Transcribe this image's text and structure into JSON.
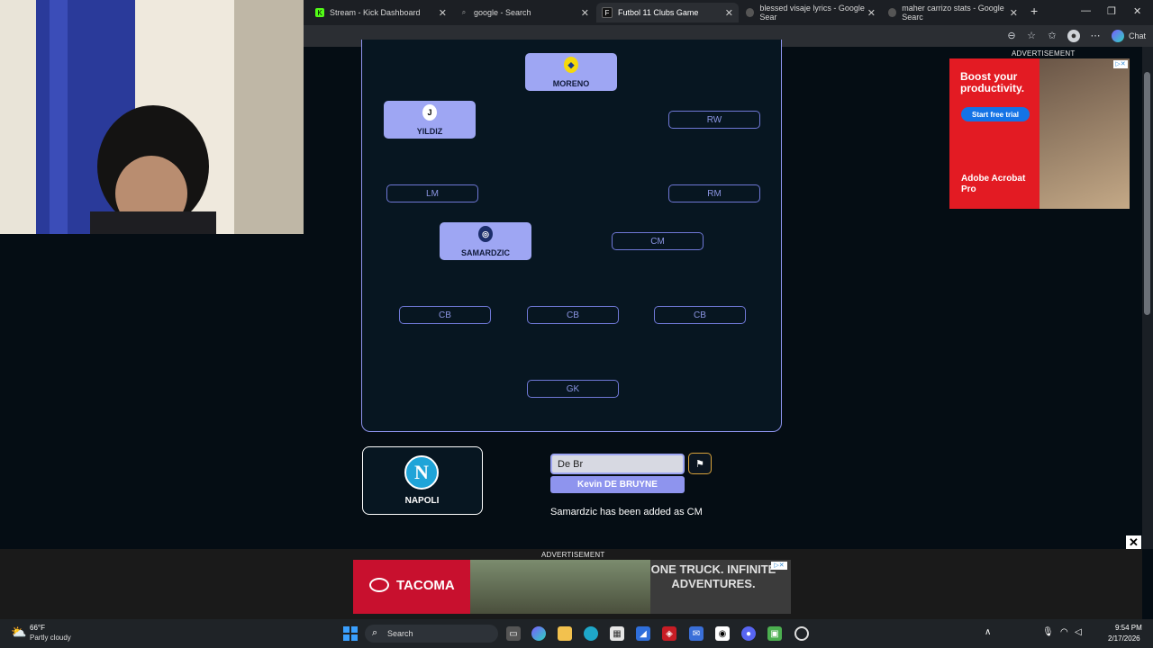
{
  "browser": {
    "tabs": [
      {
        "label": "Stream - Kick Dashboard",
        "icon": "kick-icon"
      },
      {
        "label": "google - Search",
        "icon": "search-icon"
      },
      {
        "label": "Futbol 11 Clubs Game",
        "icon": "futbol-icon",
        "active": true
      },
      {
        "label": "blessed visaje lyrics - Google Sear",
        "icon": "globe-icon"
      },
      {
        "label": "maher carrizo stats - Google Searc",
        "icon": "globe-icon"
      }
    ],
    "chat_label": "Chat"
  },
  "pitch": {
    "filled": [
      {
        "name": "MORENO",
        "club_icon": "villarreal-crest-icon"
      },
      {
        "name": "YILDIZ",
        "club_icon": "juventus-crest-icon"
      },
      {
        "name": "SAMARDZIC",
        "club_icon": "atalanta-crest-icon"
      }
    ],
    "empty": {
      "rw": "RW",
      "lm": "LM",
      "rm": "RM",
      "cm": "CM",
      "cb1": "CB",
      "cb2": "CB",
      "cb3": "CB",
      "gk": "GK"
    }
  },
  "current_club": {
    "name": "NAPOLI",
    "crest_letter": "N"
  },
  "search": {
    "value": "De Br",
    "suggestion": "Kevin DE BRUYNE"
  },
  "status_message": "Samardzic has been added as CM",
  "ads": {
    "label": "ADVERTISEMENT",
    "right": {
      "headline": "Boost your productivity.",
      "cta": "Start free trial",
      "brand": "Adobe Acrobat Pro"
    },
    "bottom": {
      "brand": "TACOMA",
      "tagline": "ONE TRUCK. INFINITE ADVENTURES."
    }
  },
  "taskbar": {
    "weather_temp": "66°F",
    "weather_desc": "Partly cloudy",
    "search_placeholder": "Search",
    "time": "9:54 PM",
    "date": "2/17/2026"
  },
  "colors": {
    "accent": "#9ea6f3",
    "flag_border": "#d8a23a",
    "napoli_blue": "#1fa4d8"
  }
}
